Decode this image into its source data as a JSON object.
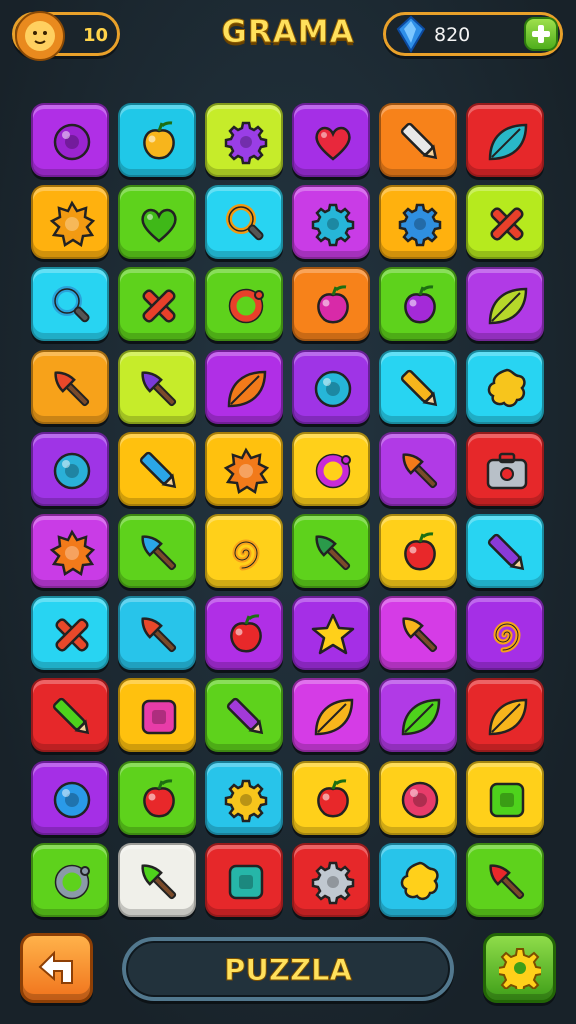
{
  "header": {
    "title": "GRAMA",
    "lives": "10",
    "gems": "820",
    "lives_icon": "lion-face-icon",
    "gems_icon": "blue-gem-icon",
    "add_icon": "plus-icon"
  },
  "board": {
    "rows": 10,
    "cols": 6,
    "tiles": [
      {
        "bg": "#b02fe6",
        "icon": "ball",
        "fg": "#9a24d0"
      },
      {
        "bg": "#20c8e8",
        "icon": "fruit",
        "fg": "#f7b51c"
      },
      {
        "bg": "#c6ec2a",
        "icon": "gear",
        "fg": "#9a3ee6"
      },
      {
        "bg": "#a52fe6",
        "icon": "heart",
        "fg": "#e8283c"
      },
      {
        "bg": "#f7821a",
        "icon": "pencil",
        "fg": "#e8e8e8"
      },
      {
        "bg": "#e6282a",
        "icon": "leaf",
        "fg": "#29b8c8"
      },
      {
        "bg": "#ffb10e",
        "icon": "sun",
        "fg": "#f29a12"
      },
      {
        "bg": "#5ed21c",
        "icon": "heart",
        "fg": "#3fb818"
      },
      {
        "bg": "#28d4f2",
        "icon": "magnifier",
        "fg": "#f29a12"
      },
      {
        "bg": "#c93ce6",
        "icon": "gear",
        "fg": "#26b6d8"
      },
      {
        "bg": "#ffb10e",
        "icon": "gear",
        "fg": "#2f8fe0"
      },
      {
        "bg": "#b6ea1e",
        "icon": "cross",
        "fg": "#e8402a"
      },
      {
        "bg": "#28d4f2",
        "icon": "magnifier",
        "fg": "#2aa2d8"
      },
      {
        "bg": "#5ed21c",
        "icon": "cross",
        "fg": "#e8402a"
      },
      {
        "bg": "#5ed21c",
        "icon": "ring",
        "fg": "#e8402a"
      },
      {
        "bg": "#f7821a",
        "icon": "fruit",
        "fg": "#d82aa8"
      },
      {
        "bg": "#5ed21c",
        "icon": "fruit",
        "fg": "#a42ad8"
      },
      {
        "bg": "#b13ae6",
        "icon": "leaf",
        "fg": "#b6d82a"
      },
      {
        "bg": "#f7a21a",
        "icon": "brush",
        "fg": "#e8482a"
      },
      {
        "bg": "#c6ec2a",
        "icon": "brush",
        "fg": "#7a3ad8"
      },
      {
        "bg": "#b02fe6",
        "icon": "leaf",
        "fg": "#f27a1a"
      },
      {
        "bg": "#9f34e6",
        "icon": "ball",
        "fg": "#26b6d8"
      },
      {
        "bg": "#28d4f2",
        "icon": "pencil",
        "fg": "#f7b51c"
      },
      {
        "bg": "#28d4f2",
        "icon": "star-blob",
        "fg": "#f7c51c"
      },
      {
        "bg": "#9f34e6",
        "icon": "ball",
        "fg": "#2ab0d8"
      },
      {
        "bg": "#ffc10e",
        "icon": "pencil",
        "fg": "#2aa6e8"
      },
      {
        "bg": "#ffc10e",
        "icon": "sun",
        "fg": "#f27a1a"
      },
      {
        "bg": "#ffd01a",
        "icon": "ring",
        "fg": "#c82ad8"
      },
      {
        "bg": "#b13ae6",
        "icon": "brush",
        "fg": "#f27a1a"
      },
      {
        "bg": "#e6282a",
        "icon": "toolbox",
        "fg": "#b8c0c8"
      },
      {
        "bg": "#c93ce6",
        "icon": "sun",
        "fg": "#f27a1a"
      },
      {
        "bg": "#5ed21c",
        "icon": "brush",
        "fg": "#2aa6e8"
      },
      {
        "bg": "#ffd01a",
        "icon": "swirl",
        "fg": "#f7a21a"
      },
      {
        "bg": "#5ed21c",
        "icon": "brush",
        "fg": "#2a9a4a"
      },
      {
        "bg": "#ffd01a",
        "icon": "fruit",
        "fg": "#e8282a"
      },
      {
        "bg": "#28d4f2",
        "icon": "pencil",
        "fg": "#8a3ad8"
      },
      {
        "bg": "#28d4f2",
        "icon": "cross",
        "fg": "#e8482a"
      },
      {
        "bg": "#28c4ea",
        "icon": "brush",
        "fg": "#e8482a"
      },
      {
        "bg": "#b02fe6",
        "icon": "fruit",
        "fg": "#e8282a"
      },
      {
        "bg": "#a52fe6",
        "icon": "star",
        "fg": "#ffd01a"
      },
      {
        "bg": "#d53ce6",
        "icon": "brush",
        "fg": "#f7b51c"
      },
      {
        "bg": "#a52fe6",
        "icon": "swirl",
        "fg": "#f7a21a"
      },
      {
        "bg": "#e6282a",
        "icon": "pencil",
        "fg": "#4ed21c"
      },
      {
        "bg": "#ffc10e",
        "icon": "square",
        "fg": "#e83ca8"
      },
      {
        "bg": "#5ed21c",
        "icon": "pencil",
        "fg": "#a23ad8"
      },
      {
        "bg": "#d53ce6",
        "icon": "leaf",
        "fg": "#f7b51c"
      },
      {
        "bg": "#b13ae6",
        "icon": "leaf",
        "fg": "#4ed21c"
      },
      {
        "bg": "#e6282a",
        "icon": "leaf",
        "fg": "#f7b51c"
      },
      {
        "bg": "#a52fe6",
        "icon": "ball",
        "fg": "#2a9ae8"
      },
      {
        "bg": "#5ed21c",
        "icon": "fruit",
        "fg": "#e8282a"
      },
      {
        "bg": "#28c4ea",
        "icon": "gear",
        "fg": "#f7c51c"
      },
      {
        "bg": "#ffd01a",
        "icon": "fruit",
        "fg": "#e8282a"
      },
      {
        "bg": "#ffd01a",
        "icon": "ball",
        "fg": "#e83c6a"
      },
      {
        "bg": "#ffd01a",
        "icon": "square",
        "fg": "#4ed21c"
      },
      {
        "bg": "#5ed21c",
        "icon": "ring",
        "fg": "#8a9aa8"
      },
      {
        "bg": "#f0f0ea",
        "icon": "brush",
        "fg": "#4ed21c"
      },
      {
        "bg": "#e6282a",
        "icon": "square",
        "fg": "#26b6a8"
      },
      {
        "bg": "#e6282a",
        "icon": "gear",
        "fg": "#c0c8d0"
      },
      {
        "bg": "#28c4ea",
        "icon": "star-blob",
        "fg": "#ffd01a"
      },
      {
        "bg": "#5ed21c",
        "icon": "brush",
        "fg": "#e8282a"
      }
    ]
  },
  "footer": {
    "back_icon": "back-arrow-icon",
    "puzzle_label": "PUZZLA",
    "settings_icon": "gear-icon"
  }
}
